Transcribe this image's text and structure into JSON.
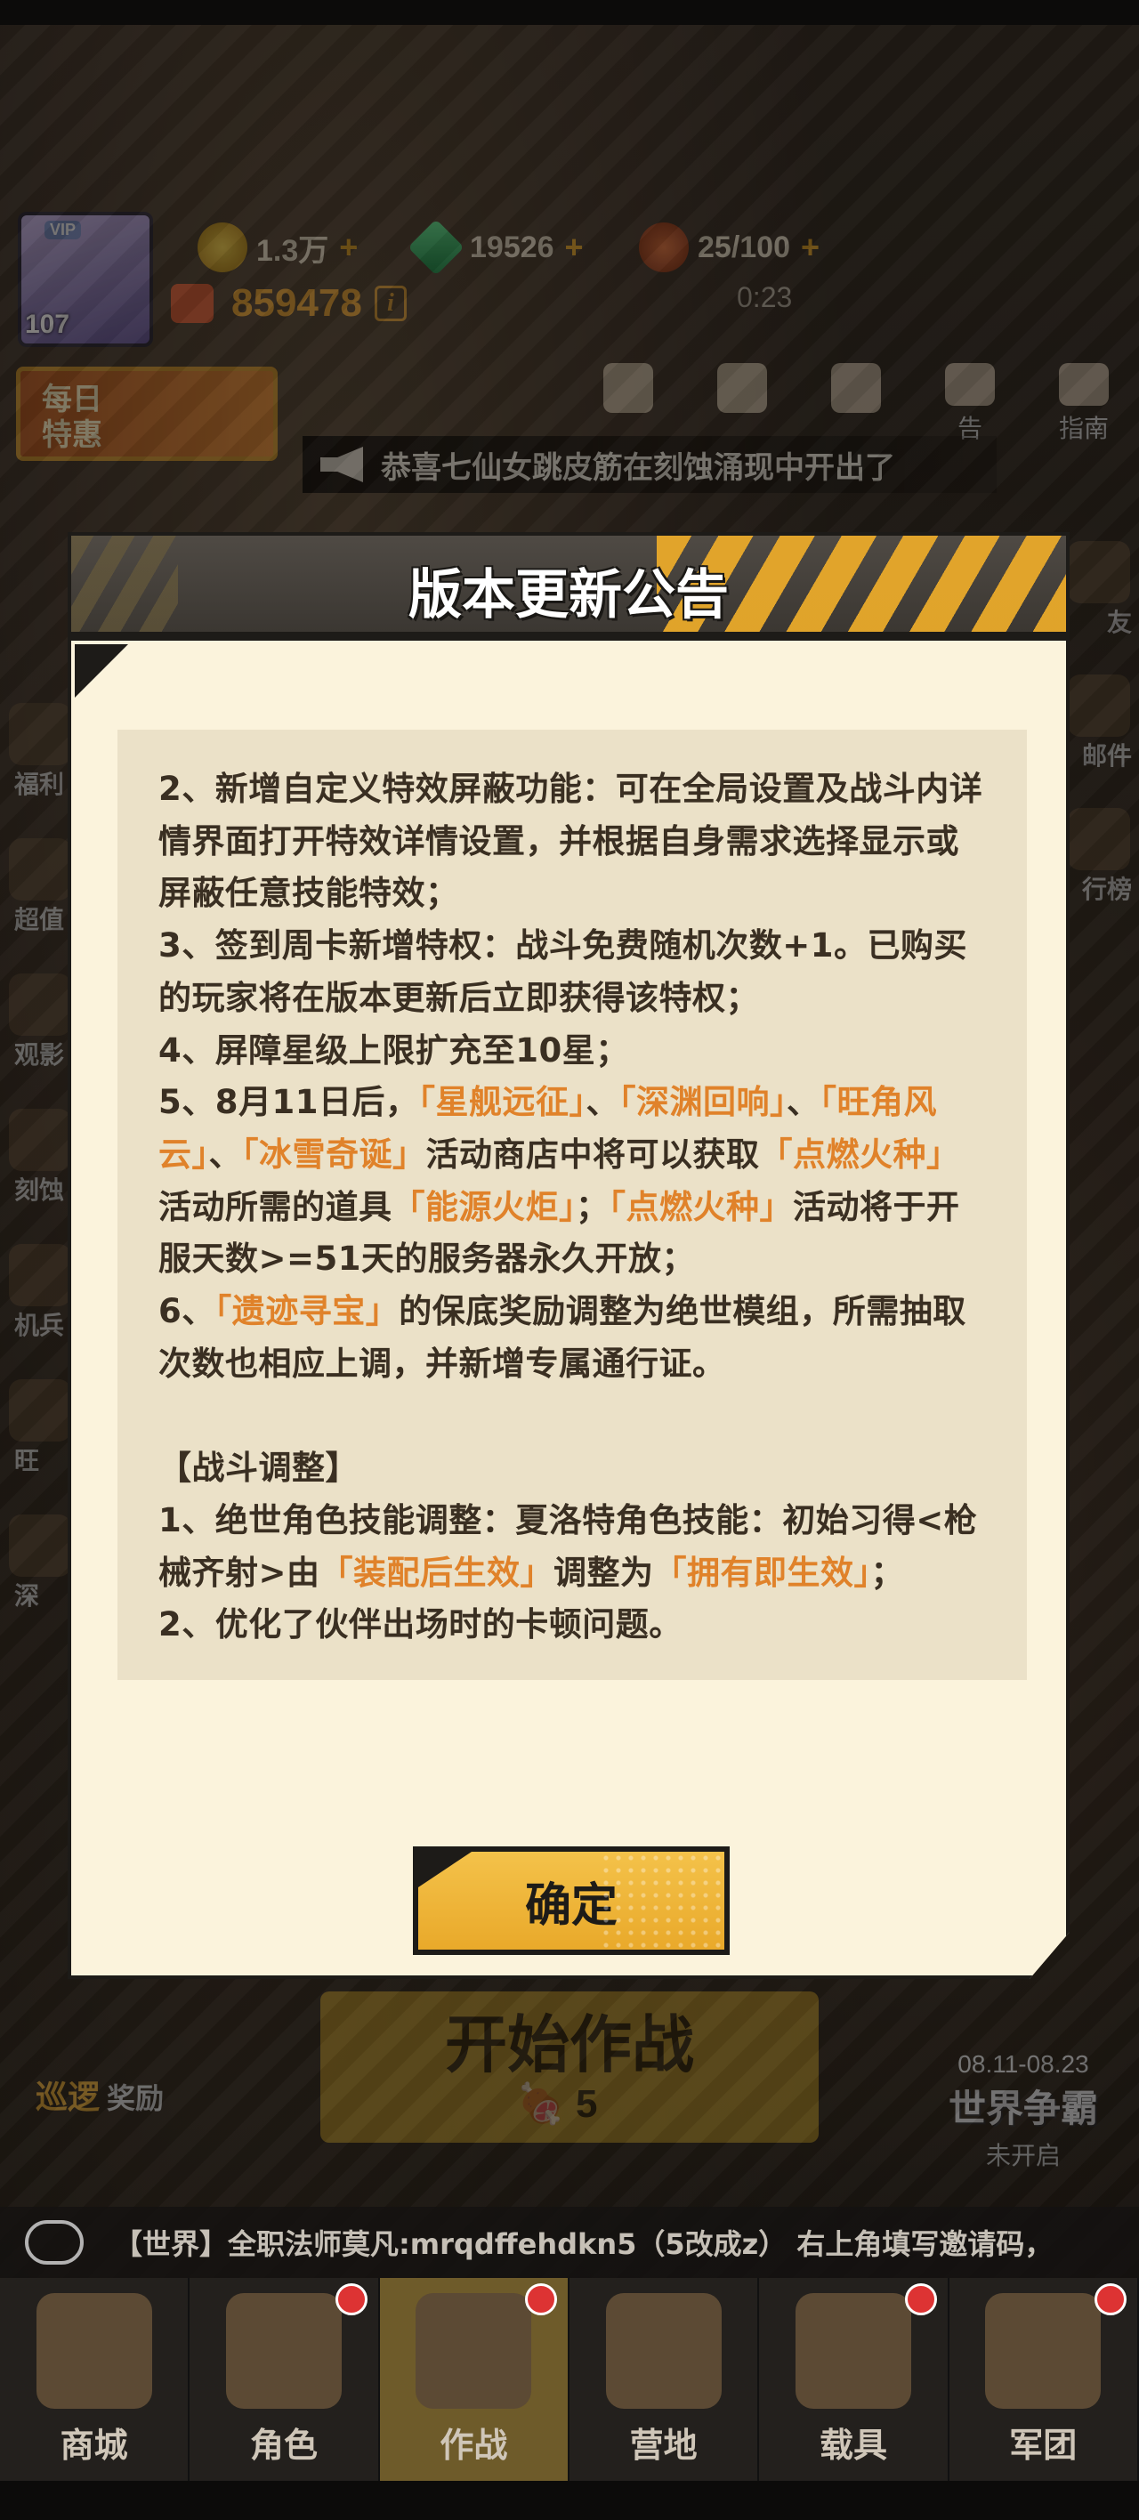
{
  "hud": {
    "vip": "VIP",
    "level": "107",
    "gold": "1.3万",
    "gems": "19526",
    "stamina": "25/100",
    "timer": "0:23",
    "power": "859478",
    "info_icon": "i"
  },
  "daily_deal": "每日特惠",
  "top_icons": [
    {
      "label": ""
    },
    {
      "label": ""
    },
    {
      "label": ""
    },
    {
      "label": "告"
    },
    {
      "label": "指南"
    }
  ],
  "marquee_text": "恭喜七仙女跳皮筋在刻蚀涌现中开出了",
  "left_icons": [
    {
      "label": "福利"
    },
    {
      "label": "超值"
    },
    {
      "label": "观影"
    },
    {
      "label": "刻蚀"
    },
    {
      "label": "机兵"
    },
    {
      "label": "旺"
    },
    {
      "label": "深"
    }
  ],
  "right_icons": [
    {
      "label": "友"
    },
    {
      "label": "邮件"
    },
    {
      "label": "行榜"
    }
  ],
  "start_button": {
    "label": "开始作战",
    "cost": "5"
  },
  "patrol": {
    "label": "巡逻",
    "sub": "奖励"
  },
  "world_war": {
    "dates": "08.11-08.23",
    "name": "世界争霸",
    "status": "未开启"
  },
  "chat": "【世界】全职法师莫凡:mrqdffehdkn5（5改成z） 右上角填写邀请码，",
  "nav": [
    {
      "label": "商城",
      "badge": false
    },
    {
      "label": "角色",
      "badge": true
    },
    {
      "label": "作战",
      "badge": true
    },
    {
      "label": "营地",
      "badge": false
    },
    {
      "label": "载具",
      "badge": true
    },
    {
      "label": "军团",
      "badge": true
    }
  ],
  "modal": {
    "title": "版本更新公告",
    "confirm": "确定",
    "text": {
      "p2": "2、新增自定义特效屏蔽功能：可在全局设置及战斗内详情界面打开特效详情设置，并根据自身需求选择显示或屏蔽任意技能特效；",
      "p3": "3、签到周卡新增特权：战斗免费随机次数+1。已购买的玩家将在版本更新后立即获得该特权；",
      "p4": "4、屏障星级上限扩充至10星；",
      "p5_a": "5、8月11日后，",
      "p5_h1": "「星舰远征」",
      "p5_b": "、",
      "p5_h2": "「深渊回响」",
      "p5_c": "、",
      "p5_h3": "「旺角风云」",
      "p5_d": "、",
      "p5_h4": "「冰雪奇诞」",
      "p5_e": "活动商店中将可以获取",
      "p5_h5": "「点燃火种」",
      "p5_f": "活动所需的道具",
      "p5_h6": "「能源火炬」",
      "p5_g": "；",
      "p5_h7": "「点燃火种」",
      "p5_i": "活动将于开服天数>=51天的服务器永久开放；",
      "p6_a": "6、",
      "p6_h1": "「遗迹寻宝」",
      "p6_b": "的保底奖励调整为绝世模组，所需抽取次数也相应上调，并新增专属通行证。",
      "battle_title": "【战斗调整】",
      "b1_a": "1、绝世角色技能调整：夏洛特角色技能：初始习得<枪械齐射>由",
      "b1_h1": "「装配后生效」",
      "b1_b": "调整为",
      "b1_h2": "「拥有即生效」",
      "b1_c": "；",
      "b2": "2、优化了伙伴出场时的卡顿问题。"
    }
  }
}
